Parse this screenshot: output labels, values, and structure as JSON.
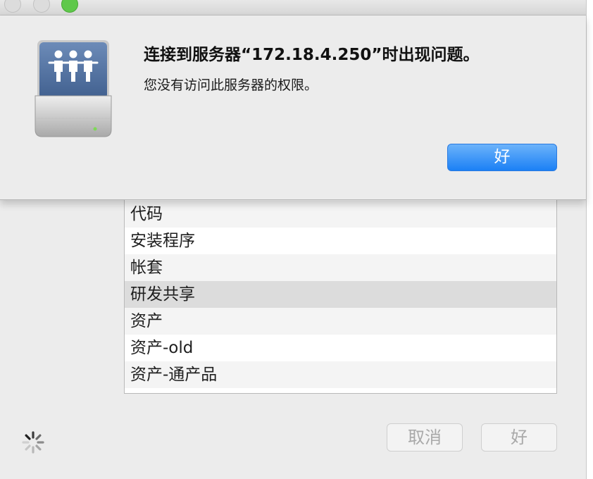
{
  "alert": {
    "title": "连接到服务器“172.18.4.250”时出现问题。",
    "message": "您没有访问此服务器的权限。",
    "ok_label": "好",
    "server_icon": "network-server-icon"
  },
  "share_list": {
    "items": [
      {
        "label": ""
      },
      {
        "label": "代码"
      },
      {
        "label": "安装程序"
      },
      {
        "label": "帐套"
      },
      {
        "label": "研发共享",
        "selected": true
      },
      {
        "label": "资产"
      },
      {
        "label": "资产-old"
      },
      {
        "label": "资产-通产品"
      }
    ]
  },
  "buttons": {
    "cancel_label": "取消",
    "ok_label": "好"
  },
  "window": {
    "traffic_lights": [
      "close-button",
      "minimize-button",
      "zoom-button"
    ]
  },
  "colors": {
    "primary_button": "#1b80f5",
    "zoom_light": "#5fc84b",
    "selected_row": "#dcdcdc"
  }
}
